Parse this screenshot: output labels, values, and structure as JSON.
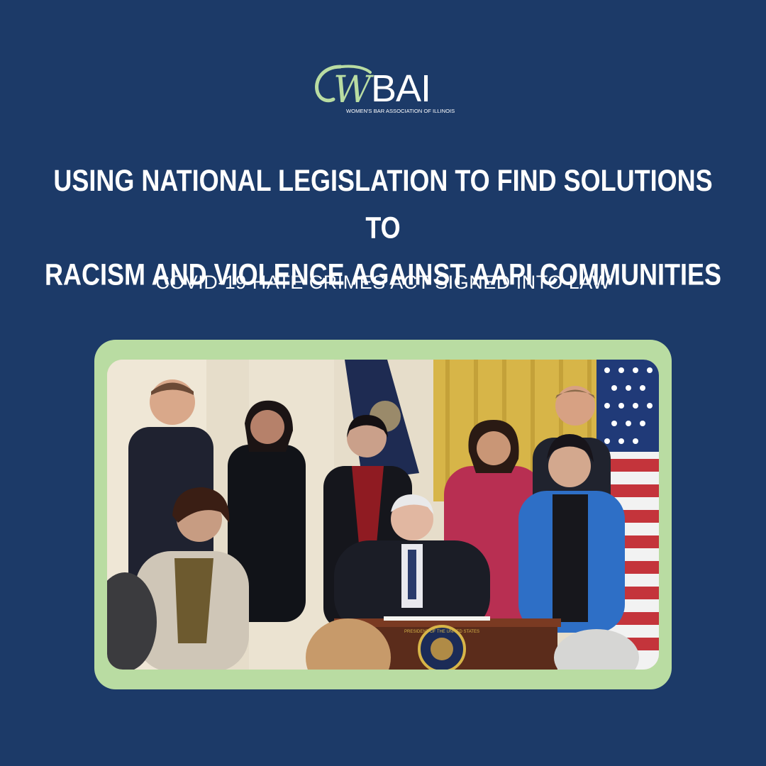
{
  "logo": {
    "letters": "BAI",
    "script_letter": "W",
    "tagline": "WOMEN'S BAR ASSOCIATION OF ILLINOIS"
  },
  "headline": {
    "line1": "USING NATIONAL LEGISLATION TO FIND SOLUTIONS TO",
    "line2": "RACISM AND VIOLENCE AGAINST AAPI COMMUNITIES"
  },
  "subheadline": "COVID-19 HATE CRIMES ACT SIGNED INTO LAW",
  "colors": {
    "background": "#1c3a68",
    "frame": "#b9dca2",
    "logo_accent": "#b9dca2",
    "text": "#ffffff"
  },
  "photo": {
    "seal_text": "PRESIDENT OF THE UNITED STATES"
  }
}
